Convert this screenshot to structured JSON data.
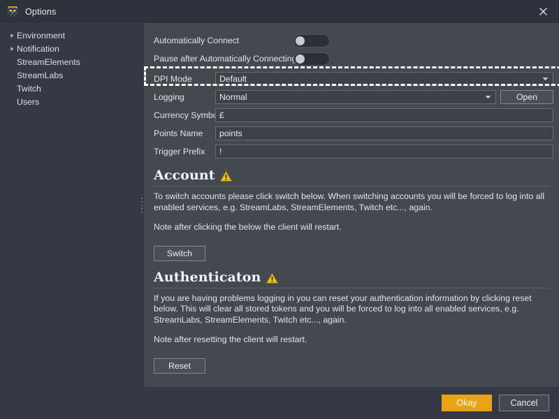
{
  "window": {
    "title": "Options",
    "app_icon": "owl-logo-icon",
    "close_icon": "close-icon"
  },
  "sidebar": {
    "items": [
      {
        "label": "Environment",
        "expandable": true,
        "icon": "chevron-right-icon"
      },
      {
        "label": "Notification",
        "expandable": true,
        "icon": "chevron-right-icon"
      },
      {
        "label": "StreamElements",
        "expandable": false,
        "icon": ""
      },
      {
        "label": "StreamLabs",
        "expandable": false,
        "icon": ""
      },
      {
        "label": "Twitch",
        "expandable": false,
        "icon": ""
      },
      {
        "label": "Users",
        "expandable": false,
        "icon": ""
      }
    ]
  },
  "splitter": {
    "name": "panel-splitter",
    "grip_icon": "drag-grip-icon"
  },
  "form": {
    "auto_connect": {
      "label": "Automatically Connect",
      "state": "off"
    },
    "pause_after": {
      "label": "Pause after Automatically Connecting",
      "state": "off"
    },
    "dpi_mode": {
      "label": "DPI Mode",
      "value": "Default",
      "caret_icon": "chevron-down-icon",
      "focused": true
    },
    "logging": {
      "label": "Logging",
      "value": "Normal",
      "caret_icon": "chevron-down-icon",
      "open_button": "Open"
    },
    "currency_symbol": {
      "label": "Currency Symbol",
      "value": "£",
      "placeholder": ""
    },
    "points_name": {
      "label": "Points Name",
      "value": "points",
      "placeholder": ""
    },
    "trigger_prefix": {
      "label": "Trigger Prefix",
      "value": "!",
      "placeholder": ""
    }
  },
  "account_section": {
    "title": "Account",
    "warning_icon": "warning-triangle-icon",
    "paragraph1": "To switch accounts please click switch below. When switching accounts you will be forced to log into all enabled services, e.g. StreamLabs, StreamElements, Twitch etc..., again.",
    "paragraph2": "Note after clicking the below the client will restart.",
    "button": "Switch"
  },
  "auth_section": {
    "title": "Authenticaton",
    "warning_icon": "warning-triangle-icon",
    "paragraph1": "If you are having problems logging in you can reset your authentication information by clicking reset below. This will clear all stored tokens and you will be forced to log into all enabled services, e.g. StreamLabs, StreamElements, Twitch etc..., again.",
    "paragraph2": "Note after resetting the client will restart.",
    "button": "Reset"
  },
  "footer": {
    "okay_label": "Okay",
    "cancel_label": "Cancel"
  },
  "colors": {
    "accent": "#e8a317",
    "warning": "#f2c033",
    "window_bg": "#343945",
    "panel_bg": "#44484f",
    "titlebar_bg": "#2e323d",
    "text": "#e3e5ea",
    "focus_dash": "#ffffff"
  }
}
